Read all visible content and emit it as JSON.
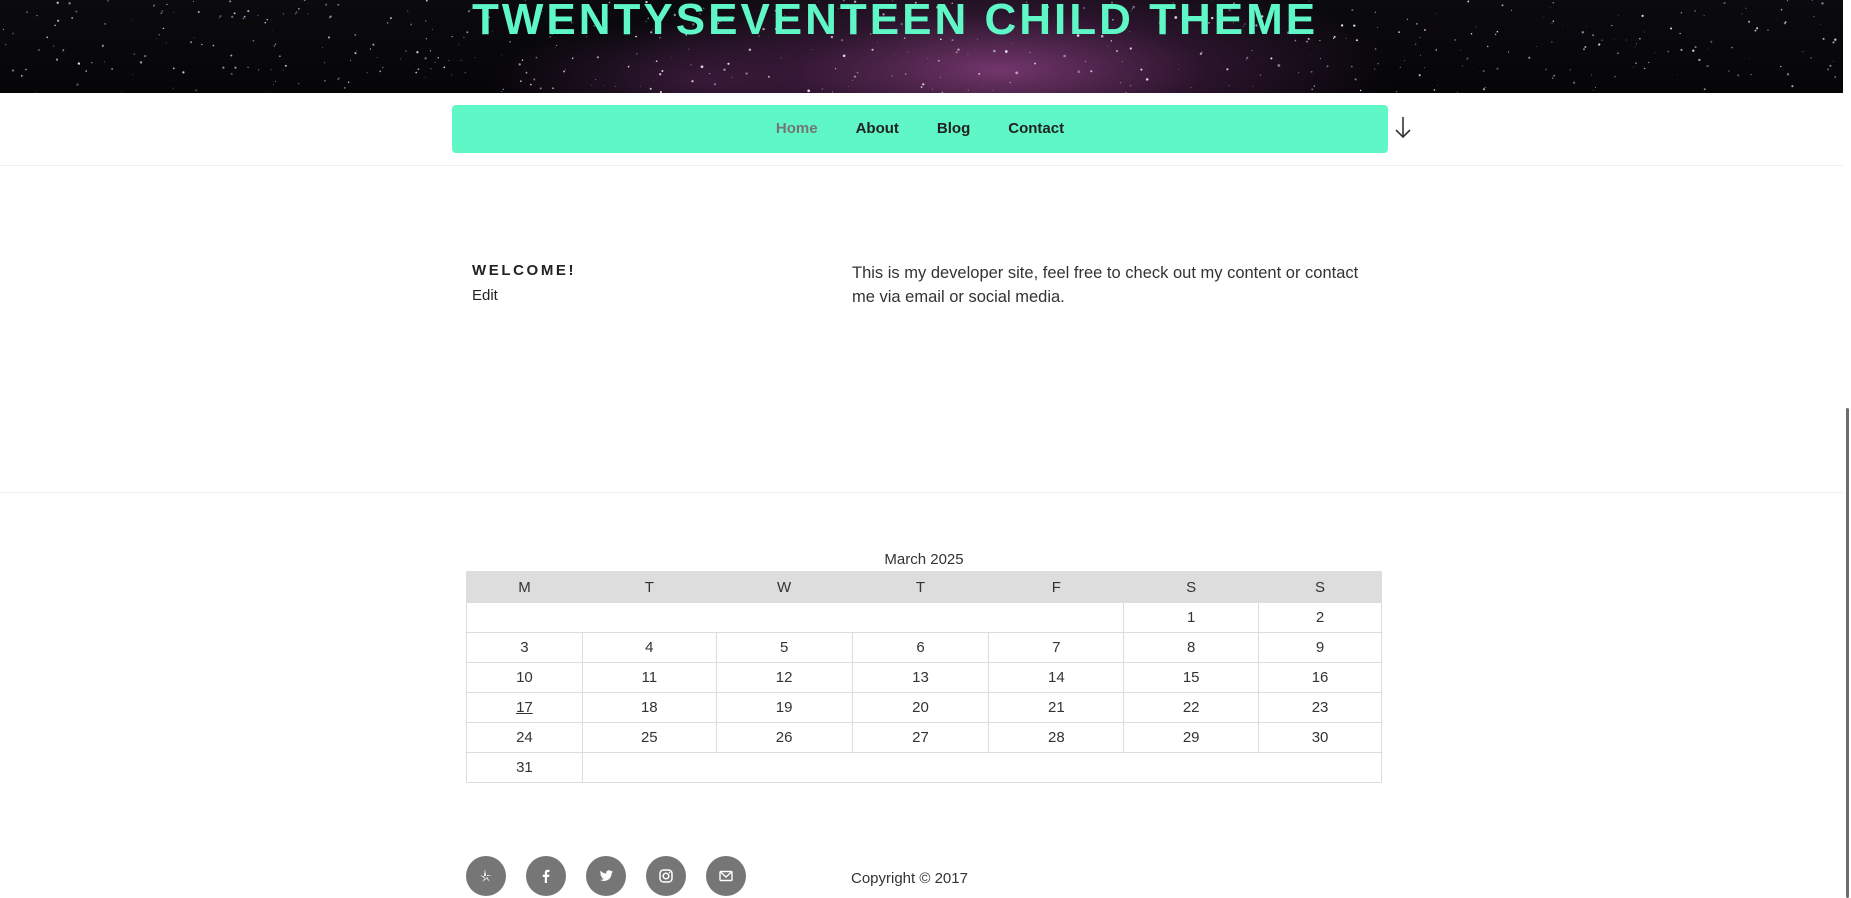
{
  "header": {
    "site_title": "TWENTYSEVENTEEN CHILD THEME"
  },
  "nav": {
    "items": [
      {
        "label": "Home",
        "current": true
      },
      {
        "label": "About"
      },
      {
        "label": "Blog"
      },
      {
        "label": "Contact"
      }
    ],
    "scroll_icon": "arrow-down-icon"
  },
  "welcome": {
    "title": "WELCOME!",
    "edit_label": "Edit",
    "text": "This is my developer site, feel free to check out my content or contact me via email or social media."
  },
  "calendar": {
    "caption": "March 2025",
    "headers": [
      "M",
      "T",
      "W",
      "T",
      "F",
      "S",
      "S"
    ],
    "week1": [
      "1",
      "2"
    ],
    "weeks": [
      [
        "3",
        "4",
        "5",
        "6",
        "7",
        "8",
        "9"
      ],
      [
        "10",
        "11",
        "12",
        "13",
        "14",
        "15",
        "16"
      ],
      [
        "17",
        "18",
        "19",
        "20",
        "21",
        "22",
        "23"
      ],
      [
        "24",
        "25",
        "26",
        "27",
        "28",
        "29",
        "30"
      ]
    ],
    "last": "31",
    "linked_day": "17"
  },
  "footer": {
    "social_icons": [
      "yelp-icon",
      "facebook-icon",
      "twitter-icon",
      "instagram-icon",
      "email-icon"
    ],
    "copyright": "Copyright © 2017"
  },
  "colors": {
    "accent": "#5ef7c5",
    "nav_current": "#767676",
    "social_bg": "#767676"
  }
}
